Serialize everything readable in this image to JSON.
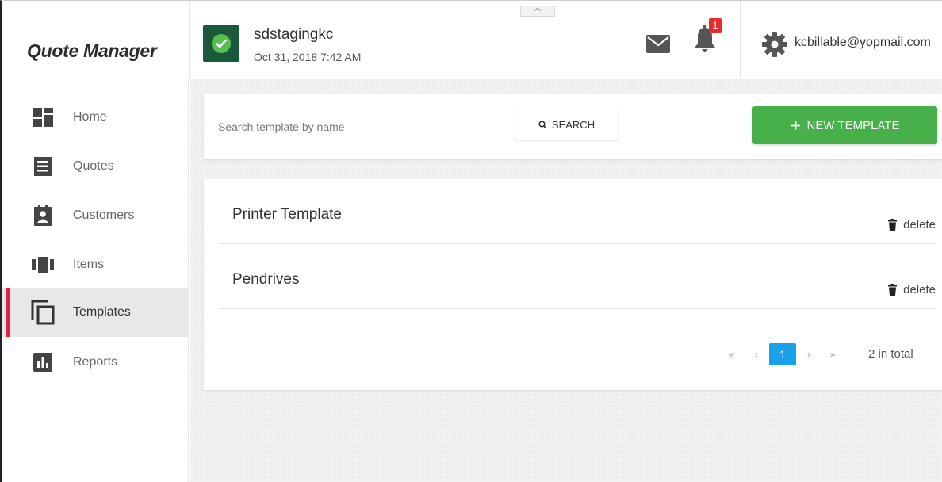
{
  "app": {
    "brand": "Quote Manager"
  },
  "header": {
    "account_name": "sdstagingkc",
    "account_date": "Oct 31, 2018 7:42 AM",
    "collapse_glyph": "^",
    "notification_count": "1",
    "user_email": "kcbillable@yopmail.com",
    "colors": {
      "account_bg": "#1a5a3a",
      "check": "#55c04d",
      "badge": "#e52d2d"
    }
  },
  "sidebar": {
    "items": [
      {
        "label": "Home",
        "icon": "dashboard-icon",
        "active": false
      },
      {
        "label": "Quotes",
        "icon": "quotes-icon",
        "active": false
      },
      {
        "label": "Customers",
        "icon": "customer-badge-icon",
        "active": false
      },
      {
        "label": "Items",
        "icon": "items-icon",
        "active": false
      },
      {
        "label": "Templates",
        "icon": "templates-icon",
        "active": true
      },
      {
        "label": "Reports",
        "icon": "reports-chart-icon",
        "active": false
      }
    ],
    "active_color": "#e0233a"
  },
  "toolbar": {
    "search_placeholder": "Search template by name",
    "search_label": "SEARCH",
    "new_template_label": "NEW TEMPLATE",
    "new_template_color": "#47b04b"
  },
  "templates": {
    "rows": [
      {
        "name": "Printer Template",
        "delete_label": "delete"
      },
      {
        "name": "Pendrives",
        "delete_label": "delete"
      }
    ]
  },
  "pagination": {
    "first": "«",
    "prev": "‹",
    "current_page": "1",
    "next": "›",
    "last": "»",
    "total_text": "2 in total",
    "current_color": "#1aa1ea"
  }
}
